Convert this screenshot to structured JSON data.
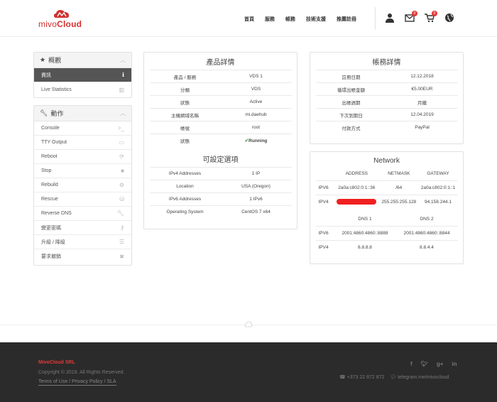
{
  "brand": {
    "logo_text_light": "mivo",
    "logo_text_bold": "Cloud",
    "accent": "#d32f2f"
  },
  "nav": [
    "首頁",
    "服務",
    "帳務",
    "技術支援",
    "推薦註冊"
  ],
  "header_icons": [
    {
      "name": "user-icon"
    },
    {
      "name": "mail-icon",
      "badge": "0"
    },
    {
      "name": "cart-icon",
      "badge": "0"
    },
    {
      "name": "globe-icon"
    }
  ],
  "sidebar_overview": {
    "title": "概觀",
    "items": [
      {
        "label": "資訊",
        "icon": "info-icon",
        "active": true
      },
      {
        "label": "Live Statistics",
        "icon": "chart-icon",
        "active": false
      }
    ]
  },
  "sidebar_actions": {
    "title": "動作",
    "items": [
      {
        "label": "Console",
        "icon": "terminal-icon"
      },
      {
        "label": "TTY Output",
        "icon": "monitor-icon"
      },
      {
        "label": "Reboot",
        "icon": "refresh-icon"
      },
      {
        "label": "Stop",
        "icon": "stop-icon"
      },
      {
        "label": "Rebuild",
        "icon": "cogs-icon"
      },
      {
        "label": "Rescue",
        "icon": "drive-icon"
      },
      {
        "label": "Reverse DNS",
        "icon": "wrench-icon"
      },
      {
        "label": "變更密碼",
        "icon": "key-icon"
      },
      {
        "label": "升級 / 降級",
        "icon": "sliders-icon"
      },
      {
        "label": "要求撤銷",
        "icon": "cross-icon"
      }
    ]
  },
  "product": {
    "title": "產品詳情",
    "rows": [
      {
        "k": "產品 / 服務",
        "v": "VDS 1"
      },
      {
        "k": "分類",
        "v": "VDS"
      },
      {
        "k": "狀態",
        "v": "Active"
      },
      {
        "k": "主機網域名稱",
        "v": "mi.daehub"
      },
      {
        "k": "帳號",
        "v": "root"
      }
    ],
    "status_label": "狀態",
    "status_value": "Running",
    "config_title": "可設定選項",
    "config_rows": [
      {
        "k": "IPv4 Addresses",
        "v": "1 IP"
      },
      {
        "k": "Location",
        "v": "USA (Oregon)"
      },
      {
        "k": "IPv6 Addresses",
        "v": "1 IPv6"
      },
      {
        "k": "Operating System",
        "v": "CentOS 7 x64"
      }
    ]
  },
  "billing": {
    "title": "帳務詳情",
    "rows": [
      {
        "k": "註冊日期",
        "v": "12.12.2018"
      },
      {
        "k": "循環出帳金額",
        "v": "€5.00EUR"
      },
      {
        "k": "出帳週期",
        "v": "月繳"
      },
      {
        "k": "下次到期日",
        "v": "12.04.2019"
      },
      {
        "k": "付款方式",
        "v": "PayPal"
      }
    ]
  },
  "network": {
    "title": "Network",
    "headers": [
      "ADDRESS",
      "NETMASK",
      "GATEWAY"
    ],
    "ipv6": {
      "label": "IPV6",
      "address": "2a0a:c802:0:1::36",
      "netmask": "/64",
      "gateway": "2a0a:c802:0:1::1"
    },
    "ipv4": {
      "label": "IPV4",
      "netmask": "255.255.255.128",
      "gateway": "94.158.244.1"
    },
    "dns_headers": [
      "DNS 1",
      "DNS 2"
    ],
    "dns": [
      {
        "label": "IPV6",
        "dns1": "2001:4860:4860::8888",
        "dns2": "2001:4860:4860::8844"
      },
      {
        "label": "IPV4",
        "dns1": "8.8.8.8",
        "dns2": "8.8.4.4"
      }
    ]
  },
  "footer": {
    "company": "MivoCloud SRL",
    "copyright": "Copyright © 2019. All Rights Reserved.",
    "links": "Terms of Use / Privacy Policy / SLA",
    "social": [
      "f",
      "t",
      "g+",
      "in"
    ],
    "phone": "+373 22 872 872",
    "telegram": "telegram.me/mivocloud"
  }
}
